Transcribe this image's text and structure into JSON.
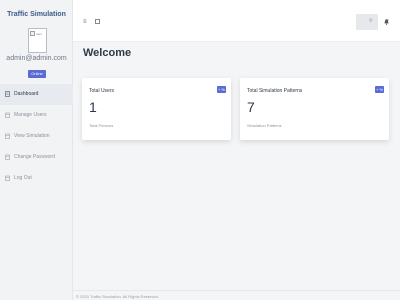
{
  "sidebar": {
    "brand": "Traffic Simulation",
    "avatar_alt": "user",
    "user_email": "admin@admin.com",
    "status": "Online",
    "items": [
      {
        "label": "Dashboard",
        "icon": "doc-icon"
      },
      {
        "label": "Manage Users",
        "icon": "calendar-icon"
      },
      {
        "label": "View Simulation",
        "icon": "calendar-icon"
      },
      {
        "label": "Change Password",
        "icon": "calendar-icon"
      },
      {
        "label": "Log Out",
        "icon": "calendar-icon"
      }
    ]
  },
  "topbar": {
    "menu_icon": "hamburger-icon",
    "fullscreen_icon": "expand-icon",
    "search_icon": "search-icon",
    "notification_icon": "bell-icon"
  },
  "main": {
    "title": "Welcome",
    "cards": [
      {
        "label": "Total Users",
        "badge": "+ %",
        "value": "1",
        "sub": "Total Persons"
      },
      {
        "label": "Total Simulation Patterns",
        "badge": "+ %",
        "value": "7",
        "sub": "Simulation Patterns"
      }
    ]
  },
  "footer": {
    "text": "© 2020 Traffic Simulation. All Rights Reserved."
  },
  "colors": {
    "accent": "#5b6bd6",
    "brand": "#3b5a8a"
  }
}
